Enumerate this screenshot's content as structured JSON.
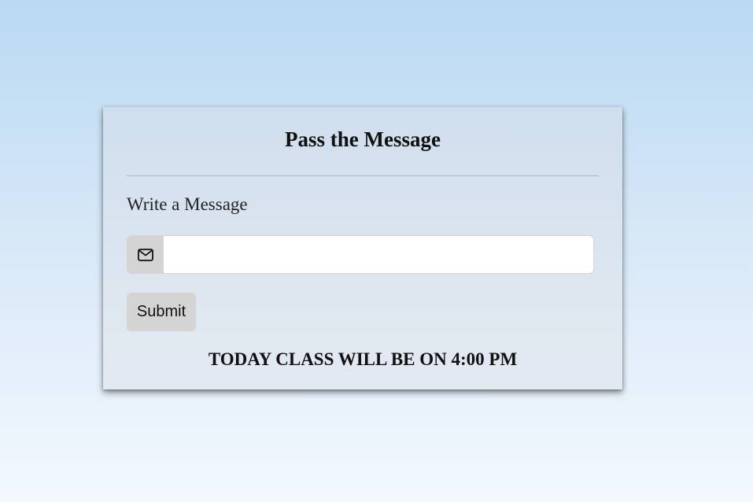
{
  "form": {
    "title": "Pass the Message",
    "label": "Write a Message",
    "input_value": "",
    "input_placeholder": "",
    "input_icon": "envelope-icon",
    "submit_label": "Submit"
  },
  "announcement": {
    "text": "TODAY CLASS WILL BE ON 4:00 PM"
  }
}
